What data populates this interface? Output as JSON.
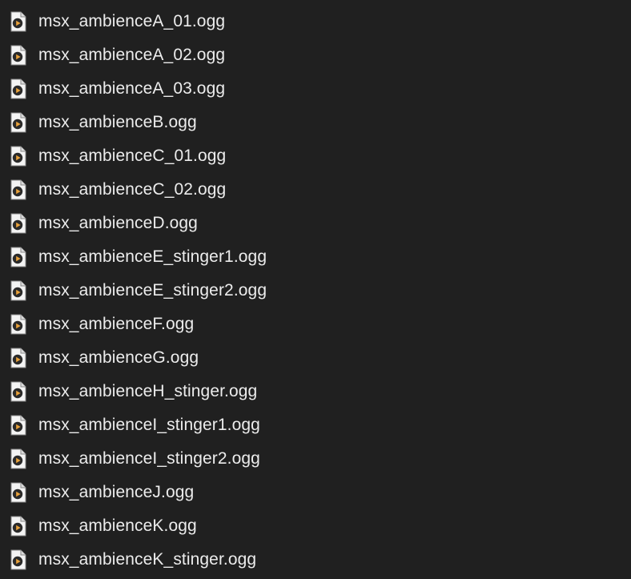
{
  "file_icon": "audio-file-play-icon",
  "files": [
    {
      "name": "msx_ambienceA_01.ogg"
    },
    {
      "name": "msx_ambienceA_02.ogg"
    },
    {
      "name": "msx_ambienceA_03.ogg"
    },
    {
      "name": "msx_ambienceB.ogg"
    },
    {
      "name": "msx_ambienceC_01.ogg"
    },
    {
      "name": "msx_ambienceC_02.ogg"
    },
    {
      "name": "msx_ambienceD.ogg"
    },
    {
      "name": "msx_ambienceE_stinger1.ogg"
    },
    {
      "name": "msx_ambienceE_stinger2.ogg"
    },
    {
      "name": "msx_ambienceF.ogg"
    },
    {
      "name": "msx_ambienceG.ogg"
    },
    {
      "name": "msx_ambienceH_stinger.ogg"
    },
    {
      "name": "msx_ambienceI_stinger1.ogg"
    },
    {
      "name": "msx_ambienceI_stinger2.ogg"
    },
    {
      "name": "msx_ambienceJ.ogg"
    },
    {
      "name": "msx_ambienceK.ogg"
    },
    {
      "name": "msx_ambienceK_stinger.ogg"
    }
  ]
}
